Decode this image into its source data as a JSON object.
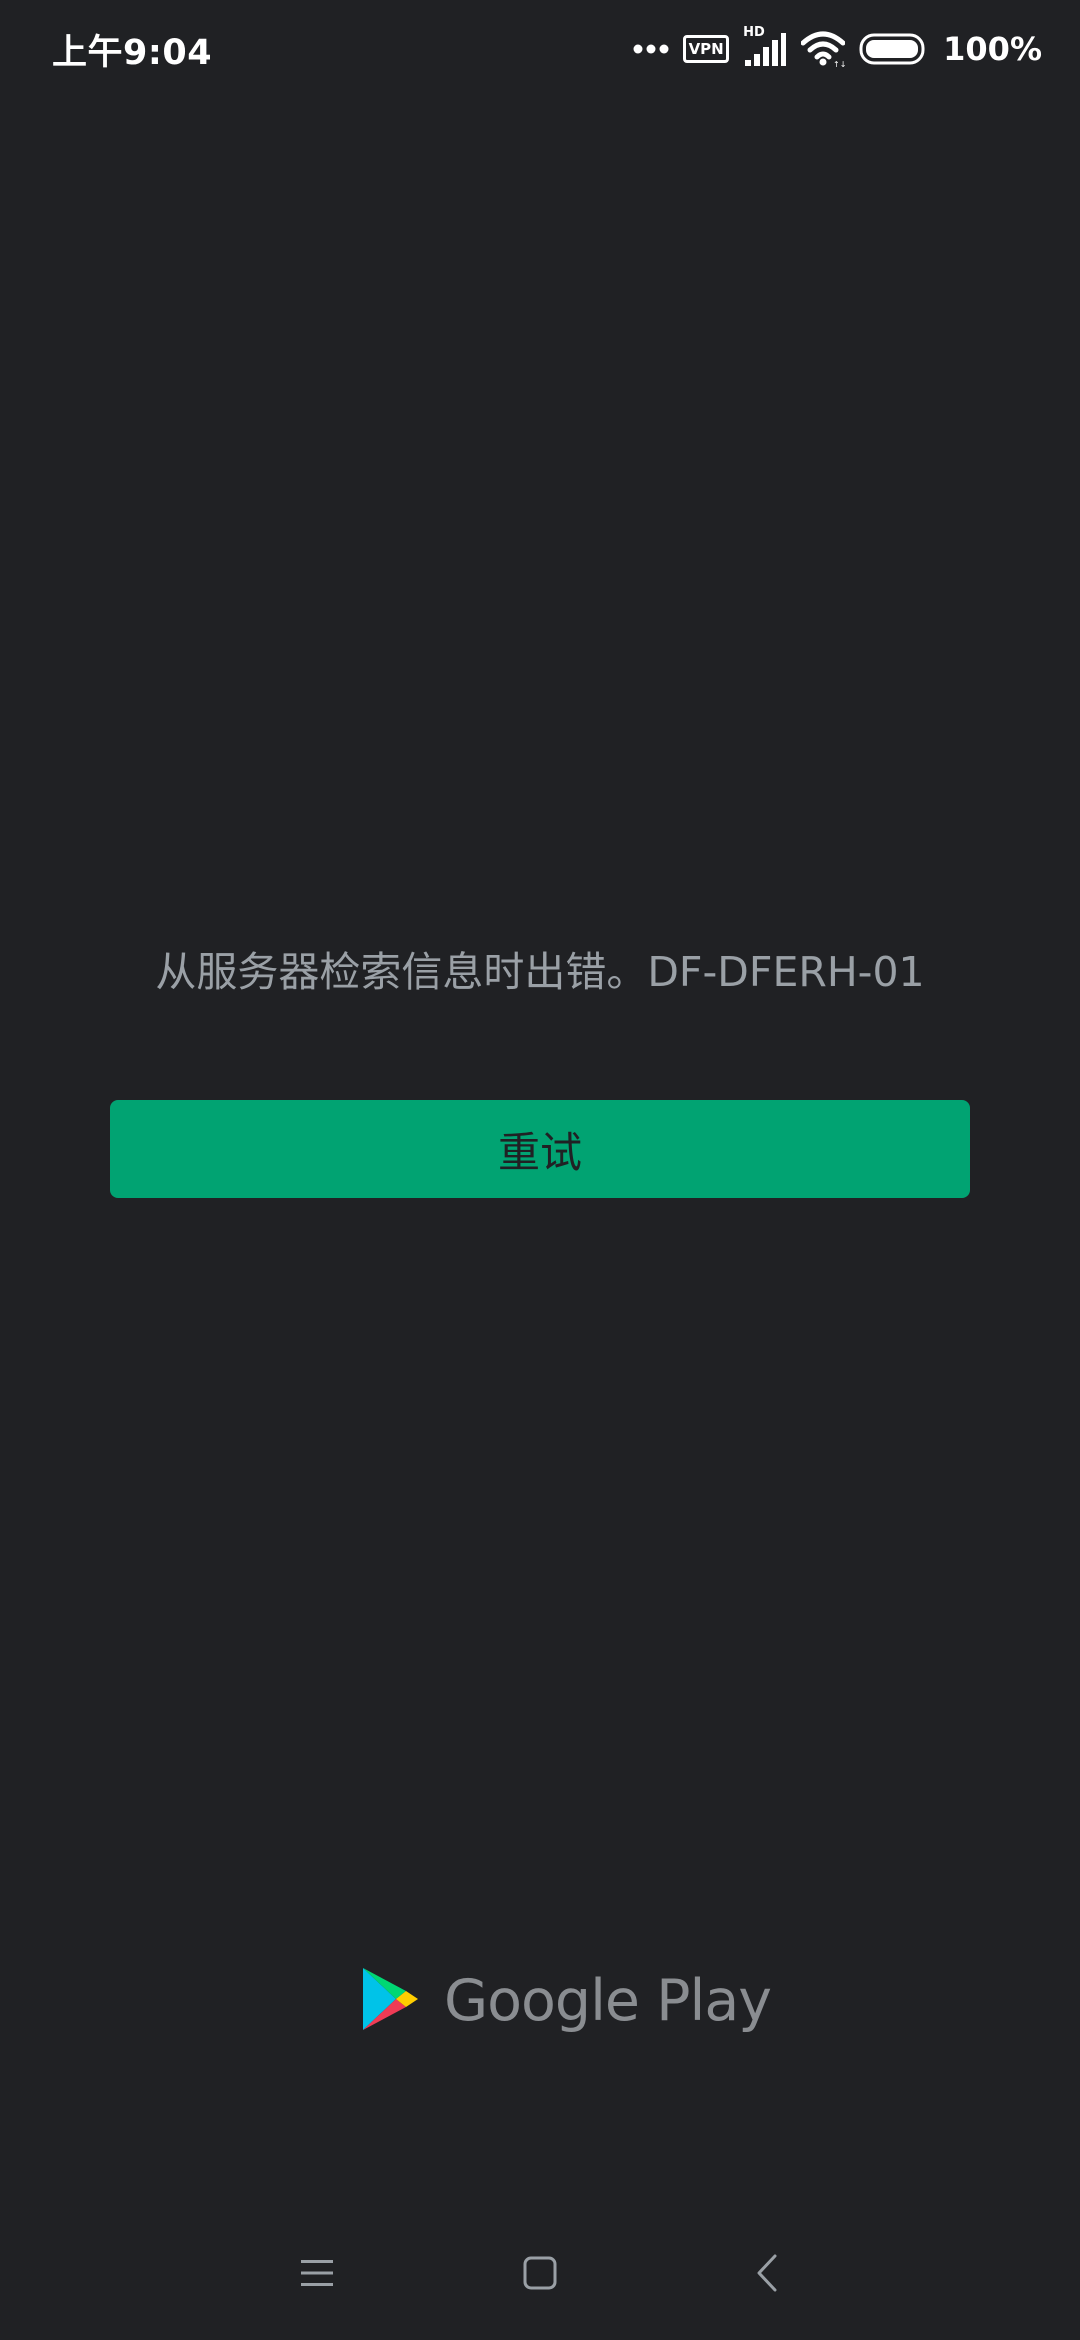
{
  "status_bar": {
    "time": "上午9:04",
    "vpn_label": "VPN",
    "hd_label": "HD",
    "battery_percent": "100%",
    "battery_level": 1.0,
    "icons": [
      "more-dots-icon",
      "vpn-icon",
      "hd-signal-icon",
      "wifi-icon",
      "battery-icon"
    ]
  },
  "main": {
    "error_message": "从服务器检索信息时出错。DF-DFERH-01",
    "retry_label": "重试"
  },
  "branding": {
    "wordmark": "Google Play",
    "icon": "google-play-icon"
  },
  "nav_bar": {
    "icons": [
      "menu-icon",
      "home-icon",
      "back-icon"
    ]
  },
  "colors": {
    "background": "#202124",
    "accent": "#01a372",
    "message_text": "#9aa0a6",
    "button_text": "#202124",
    "nav_icon": "#9aa0a6"
  }
}
